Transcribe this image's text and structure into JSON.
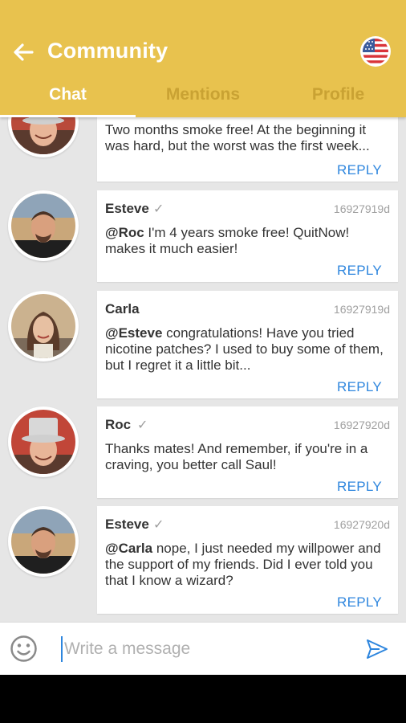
{
  "header": {
    "title": "Community",
    "back_icon": "arrow-left-icon",
    "flag_icon": "us-flag-icon",
    "bg_color": "#e8c24e"
  },
  "tabs": [
    {
      "label": "Chat",
      "active": true
    },
    {
      "label": "Mentions",
      "active": false
    },
    {
      "label": "Profile",
      "active": false
    }
  ],
  "messages": [
    {
      "author": "",
      "verified": false,
      "time": "",
      "mention": "",
      "text": "Two months smoke free! At the beginning it was hard, but the worst was the first week...",
      "reply": "REPLY",
      "avatar": "roc"
    },
    {
      "author": "Esteve",
      "verified": true,
      "time": "16927919d",
      "mention": "@Roc",
      "text": " I'm 4 years smoke free! QuitNow! makes it much easier!",
      "reply": "REPLY",
      "avatar": "esteve"
    },
    {
      "author": "Carla",
      "verified": false,
      "time": "16927919d",
      "mention": "@Esteve",
      "text": " congratulations! Have you tried nicotine patches? I used to buy some of them, but I regret it a little bit...",
      "reply": "REPLY",
      "avatar": "carla"
    },
    {
      "author": "Roc",
      "verified": true,
      "time": "16927920d",
      "mention": "",
      "text": "Thanks mates! And remember, if you're in a craving, you better call Saul!",
      "reply": "REPLY",
      "avatar": "roc"
    },
    {
      "author": "Esteve",
      "verified": true,
      "time": "16927920d",
      "mention": "@Carla",
      "text": " nope, I just needed my willpower and the support of my friends. Did I ever told you that I know a wizard?",
      "reply": "REPLY",
      "avatar": "esteve"
    }
  ],
  "composer": {
    "placeholder": "Write a message",
    "emoji_icon": "smiley-icon",
    "send_icon": "send-icon"
  },
  "colors": {
    "accent": "#2e86de",
    "header": "#e8c24e",
    "feed_bg": "#e6e6e6"
  }
}
